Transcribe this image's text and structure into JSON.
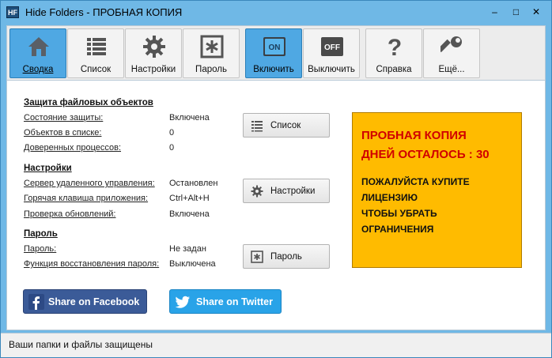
{
  "window": {
    "title": "Hide Folders - ПРОБНАЯ КОПИЯ",
    "icon_text": "HF",
    "controls": {
      "minimize": "–",
      "maximize": "□",
      "close": "✕"
    }
  },
  "toolbar": {
    "items": [
      {
        "label": "Сводка",
        "icon": "home-icon",
        "active": true
      },
      {
        "label": "Список",
        "icon": "list-icon",
        "active": false
      },
      {
        "label": "Настройки",
        "icon": "gear-icon",
        "active": false
      },
      {
        "label": "Пароль",
        "icon": "password-icon",
        "active": false
      },
      {
        "label": "Включить",
        "icon": "power-on-icon",
        "icon_text": "ON",
        "active": true
      },
      {
        "label": "Выключить",
        "icon": "power-off-icon",
        "icon_text": "OFF",
        "active": false
      },
      {
        "label": "Справка",
        "icon": "help-icon",
        "active": false
      },
      {
        "label": "Ещё...",
        "icon": "wrench-icon",
        "active": false
      }
    ]
  },
  "protection": {
    "title": "Защита файловых объектов",
    "rows": [
      {
        "label": "Состояние защиты:",
        "value": "Включена"
      },
      {
        "label": "Объектов в списке:",
        "value": "0"
      },
      {
        "label": "Доверенных процессов:",
        "value": "0"
      }
    ],
    "button": "Список"
  },
  "settings": {
    "title": "Настройки",
    "rows": [
      {
        "label": "Сервер удаленного управления:",
        "value": "Остановлен"
      },
      {
        "label": "Горячая клавиша приложения:",
        "value": "Ctrl+Alt+H"
      },
      {
        "label": "Проверка обновлений:",
        "value": "Включена"
      }
    ],
    "button": "Настройки"
  },
  "password": {
    "title": "Пароль",
    "rows": [
      {
        "label": "Пароль:",
        "value": "Не задан"
      },
      {
        "label": "Функция восстановления пароля:",
        "value": "Выключена"
      }
    ],
    "button": "Пароль"
  },
  "trial": {
    "line1": "ПРОБНАЯ КОПИЯ",
    "line2": "ДНЕЙ ОСТАЛОСЬ : 30",
    "message": [
      "ПОЖАЛУЙСТА КУПИТЕ",
      "ЛИЦЕНЗИЮ",
      "ЧТОБЫ УБРАТЬ",
      "ОГРАНИЧЕНИЯ"
    ]
  },
  "social": {
    "facebook": "Share on Facebook",
    "twitter": "Share on Twitter"
  },
  "status": "Ваши папки и файлы защищены",
  "colors": {
    "title_bar": "#6fb8e6",
    "active_tab": "#4fa8e3",
    "trial_bg": "#ffbb00",
    "trial_red": "#d10000",
    "facebook": "#3b5b98",
    "twitter": "#29a3e8"
  }
}
